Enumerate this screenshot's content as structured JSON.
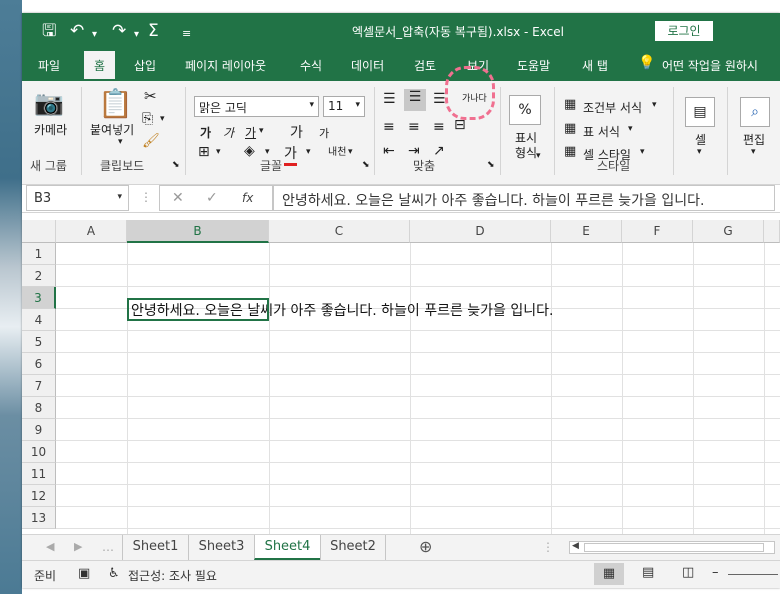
{
  "titlebar": {
    "title": "엑셀문서_압축(자동 복구됨).xlsx  -  Excel",
    "login_label": "로그인"
  },
  "tabs": [
    "파일",
    "홈",
    "삽입",
    "페이지 레이아웃",
    "수식",
    "데이터",
    "검토",
    "보기",
    "도움말",
    "새 탭"
  ],
  "active_tab": "홈",
  "tell_me": "어떤 작업을 원하시",
  "ribbon": {
    "camera_label": "카메라",
    "paste_label": "붙여넣기",
    "font_name": "맑은 고딕",
    "font_size": "11",
    "bold_label": "가",
    "italic_label": "가",
    "underline_label": "가",
    "grow_font": "가",
    "shrink_font": "가",
    "font_color": "가",
    "phonetic": "내천",
    "wrap_text": "가나다",
    "number_label": "표시 형식",
    "cond_format": "조건부 서식",
    "table_format": "표 서식",
    "cell_style": "셀 스타일",
    "cells_label": "셀",
    "edit_label": "편집",
    "groups": {
      "new_group": "새 그룹",
      "clipboard": "클립보드",
      "font": "글꼴",
      "align": "맞춤",
      "style": "스타일"
    },
    "colors": {
      "accent": "#217346",
      "highlight": "#f07090"
    }
  },
  "formula": {
    "name_box": "B3",
    "content": "안녕하세요. 오늘은 날씨가 아주 좋습니다. 하늘이 푸르른 늦가을 입니다."
  },
  "columns": [
    "A",
    "B",
    "C",
    "D",
    "E",
    "F",
    "G"
  ],
  "rows": [
    "1",
    "2",
    "3",
    "4",
    "5",
    "6",
    "7",
    "8",
    "9",
    "10",
    "11",
    "12",
    "13"
  ],
  "cell_b3": "안녕하세요. 오늘은 날씨가 아주 좋습니다. 하늘이 푸르른 늦가을 입니다.",
  "sheets": [
    "Sheet1",
    "Sheet3",
    "Sheet4",
    "Sheet2"
  ],
  "active_sheet": "Sheet4",
  "status": {
    "ready": "준비",
    "accessibility": "접근성: 조사 필요"
  }
}
